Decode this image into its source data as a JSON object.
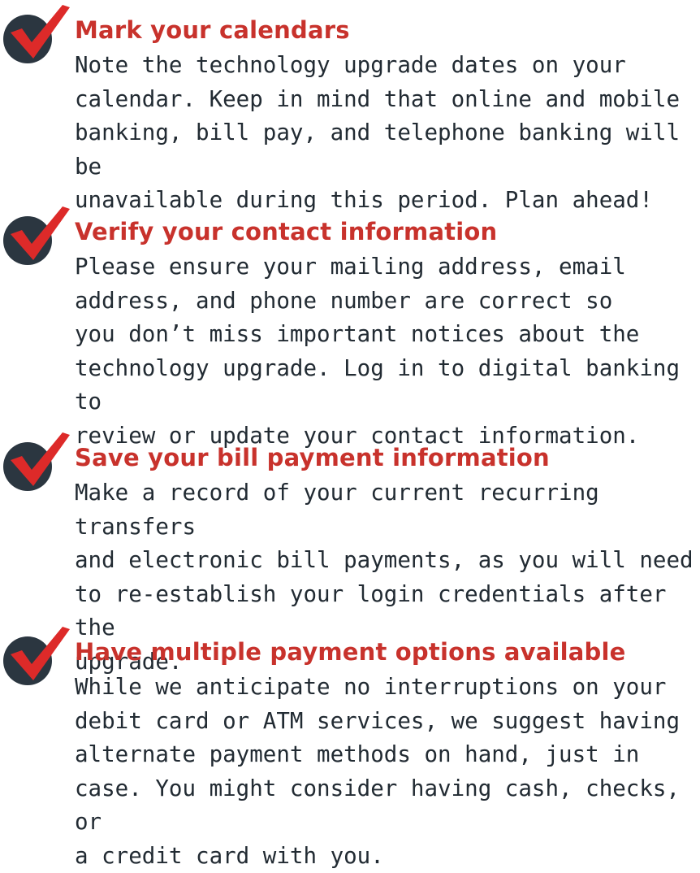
{
  "colors": {
    "title_red": "#c8322c",
    "body_text": "#222b33",
    "badge_circle": "#2b3640",
    "check_mark": "#dd2a29"
  },
  "icons": {
    "badge": "checkmark-circle-icon"
  },
  "items": [
    {
      "title": "Mark your calendars",
      "body": "Note the technology upgrade dates on your\ncalendar. Keep in mind that online and mobile\nbanking, bill pay, and telephone banking will be\nunavailable during this period. Plan ahead!"
    },
    {
      "title": "Verify your contact information",
      "body": "Please ensure your mailing address, email\naddress, and phone number are correct so\nyou don’t miss important notices about the\ntechnology upgrade. Log in to digital banking to\nreview or update your contact information."
    },
    {
      "title": "Save your bill payment information",
      "body": "Make a record of your current recurring transfers\nand electronic bill payments, as you will need\nto re-establish your login credentials after the\nupgrade."
    },
    {
      "title": "Have multiple payment options available",
      "body": "While we anticipate no interruptions on your\ndebit card or ATM services, we suggest having\nalternate payment methods on hand, just in\ncase. You might consider having cash, checks, or\na credit card with you."
    }
  ]
}
